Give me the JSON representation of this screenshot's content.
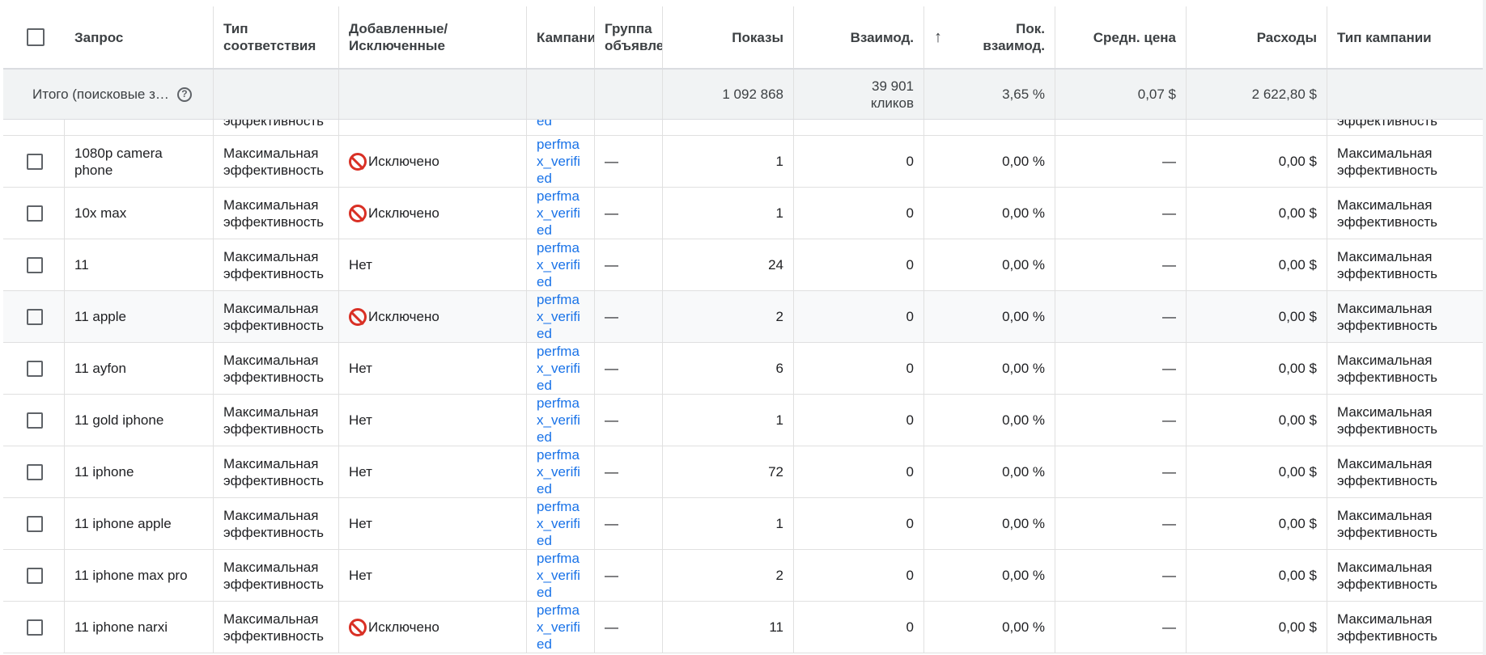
{
  "header": {
    "query": "Запрос",
    "match_type": "Тип соответствия",
    "added_excluded": "Добавленные/ Исключенные",
    "campaign": "Кампания",
    "ad_group": "Группа объявлений",
    "impressions": "Показы",
    "interactions": "Взаимод.",
    "interaction_rate": "Пок. взаимод.",
    "avg_cost": "Средн. цена",
    "cost": "Расходы",
    "campaign_type": "Тип кампании"
  },
  "total": {
    "label": "Итого (поисковые з…",
    "help_icon": "help-circle-icon",
    "impressions": "1 092 868",
    "interactions": "39 901 кликов",
    "interaction_rate": "3,65 %",
    "avg_cost": "0,07 $",
    "cost": "2 622,80 $"
  },
  "partial_row": {
    "match_type": "эффективность",
    "campaign": "ed",
    "campaign_type": "эффективность"
  },
  "rows": [
    {
      "query": "1080p camera phone",
      "match_type": "Максимальная эффективность",
      "status": "Исключено",
      "excluded": true,
      "campaign": "perfmax_verified",
      "ad_group": "—",
      "impressions": "1",
      "interactions": "0",
      "interaction_rate": "0,00 %",
      "avg_cost": "—",
      "cost": "0,00 $",
      "campaign_type": "Максимальная эффективность"
    },
    {
      "query": "10x max",
      "match_type": "Максимальная эффективность",
      "status": "Исключено",
      "excluded": true,
      "campaign": "perfmax_verified",
      "ad_group": "—",
      "impressions": "1",
      "interactions": "0",
      "interaction_rate": "0,00 %",
      "avg_cost": "—",
      "cost": "0,00 $",
      "campaign_type": "Максимальная эффективность"
    },
    {
      "query": "11",
      "match_type": "Максимальная эффективность",
      "status": "Нет",
      "excluded": false,
      "campaign": "perfmax_verified",
      "ad_group": "—",
      "impressions": "24",
      "interactions": "0",
      "interaction_rate": "0,00 %",
      "avg_cost": "—",
      "cost": "0,00 $",
      "campaign_type": "Максимальная эффективность"
    },
    {
      "query": "11 apple",
      "match_type": "Максимальная эффективность",
      "status": "Исключено",
      "excluded": true,
      "campaign": "perfmax_verified",
      "ad_group": "—",
      "impressions": "2",
      "interactions": "0",
      "interaction_rate": "0,00 %",
      "avg_cost": "—",
      "cost": "0,00 $",
      "campaign_type": "Максимальная эффективность",
      "highlight": true
    },
    {
      "query": "11 ayfon",
      "match_type": "Максимальная эффективность",
      "status": "Нет",
      "excluded": false,
      "campaign": "perfmax_verified",
      "ad_group": "—",
      "impressions": "6",
      "interactions": "0",
      "interaction_rate": "0,00 %",
      "avg_cost": "—",
      "cost": "0,00 $",
      "campaign_type": "Максимальная эффективность"
    },
    {
      "query": "11 gold iphone",
      "match_type": "Максимальная эффективность",
      "status": "Нет",
      "excluded": false,
      "campaign": "perfmax_verified",
      "ad_group": "—",
      "impressions": "1",
      "interactions": "0",
      "interaction_rate": "0,00 %",
      "avg_cost": "—",
      "cost": "0,00 $",
      "campaign_type": "Максимальная эффективность"
    },
    {
      "query": "11 iphone",
      "match_type": "Максимальная эффективность",
      "status": "Нет",
      "excluded": false,
      "campaign": "perfmax_verified",
      "ad_group": "—",
      "impressions": "72",
      "interactions": "0",
      "interaction_rate": "0,00 %",
      "avg_cost": "—",
      "cost": "0,00 $",
      "campaign_type": "Максимальная эффективность"
    },
    {
      "query": "11 iphone apple",
      "match_type": "Максимальная эффективность",
      "status": "Нет",
      "excluded": false,
      "campaign": "perfmax_verified",
      "ad_group": "—",
      "impressions": "1",
      "interactions": "0",
      "interaction_rate": "0,00 %",
      "avg_cost": "—",
      "cost": "0,00 $",
      "campaign_type": "Максимальная эффективность"
    },
    {
      "query": "11 iphone max pro",
      "match_type": "Максимальная эффективность",
      "status": "Нет",
      "excluded": false,
      "campaign": "perfmax_verified",
      "ad_group": "—",
      "impressions": "2",
      "interactions": "0",
      "interaction_rate": "0,00 %",
      "avg_cost": "—",
      "cost": "0,00 $",
      "campaign_type": "Максимальная эффективность"
    },
    {
      "query": "11 iphone narxi",
      "match_type": "Максимальная эффективность",
      "status": "Исключено",
      "excluded": true,
      "campaign": "perfmax_verified",
      "ad_group": "—",
      "impressions": "11",
      "interactions": "0",
      "interaction_rate": "0,00 %",
      "avg_cost": "—",
      "cost": "0,00 $",
      "campaign_type": "Максимальная эффективность"
    }
  ],
  "colors": {
    "link": "#1a73e8",
    "excluded": "#d93025",
    "header_border": "#dadce0"
  }
}
